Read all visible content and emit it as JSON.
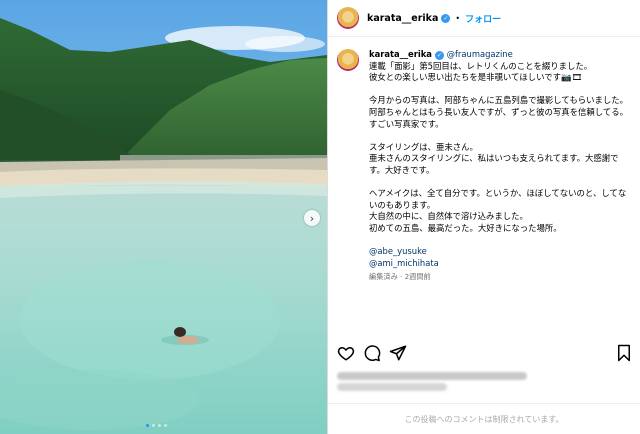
{
  "post": {
    "username": "karata__erika",
    "follow_label": "フォロー",
    "separator": "•",
    "caption_mention": "@fraumagazine",
    "caption_paragraphs": [
      "連載「面影」第5回目は、レトリくんのことを綴りました。\n彼女との楽しい思い出たちを是非覗いてほしいです📷🎞",
      "今月からの写真は、阿部ちゃんに五島列島で撮影してもらいました。\n阿部ちゃんとはもう長い友人ですが、ずっと彼の写真を信頼してる。すごい写真家です。",
      "スタイリングは、亜未さん。\n亜未さんのスタイリングに、私はいつも支えられてます。大感謝です。大好きです。",
      "ヘアメイクは、全て自分です。というか、ほぼしてないのと、してないのもあります。\n大自然の中に、自然体で溶け込みました。\n初めての五島、最高だった。大好きになった場所。"
    ],
    "mentions": [
      "@abe_yusuke",
      "@ami_michihata"
    ],
    "meta": "編集済み · 2週間前",
    "comments_disabled": "この投稿へのコメントは制限されています。"
  },
  "carousel": {
    "total_slides": 4,
    "active_slide": 1
  },
  "colors": {
    "accent": "#0095f6",
    "mention": "#00376b",
    "verified": "#3897f0",
    "muted": "#737373"
  },
  "icons": [
    "verified-badge-icon",
    "heart-icon",
    "comment-icon",
    "share-icon",
    "bookmark-icon",
    "chevron-right-icon"
  ]
}
